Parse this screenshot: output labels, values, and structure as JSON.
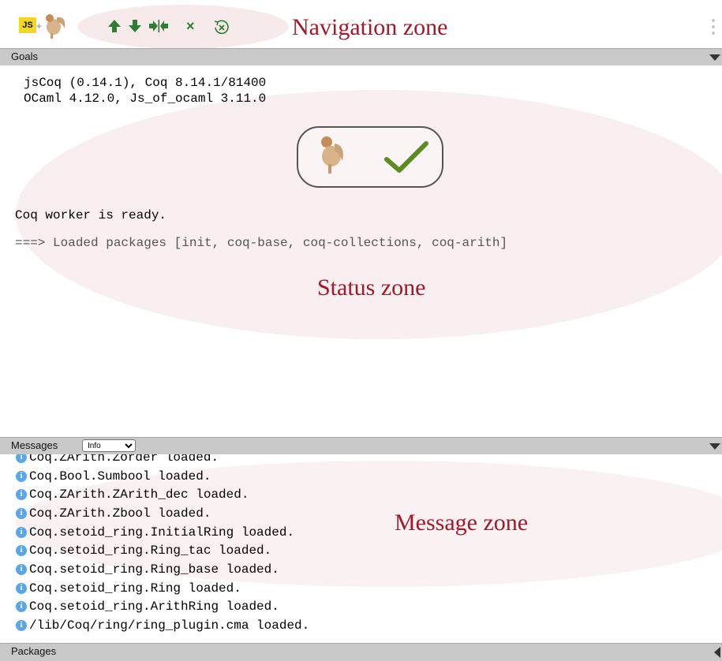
{
  "toolbar": {
    "js_logo": "JS",
    "plus": "+",
    "buttons": [
      {
        "name": "up-arrow-icon",
        "label": "▲"
      },
      {
        "name": "down-arrow-icon",
        "label": "▼"
      },
      {
        "name": "to-cursor-icon",
        "label": "▶|◀"
      },
      {
        "name": "close-icon",
        "label": "×"
      },
      {
        "name": "reset-icon",
        "label": "↺"
      }
    ]
  },
  "annotations": {
    "navigation": "Navigation zone",
    "status": "Status zone",
    "message": "Message zone"
  },
  "goals_panel": {
    "title": "Goals",
    "version_line1": "jsCoq (0.14.1), Coq 8.14.1/81400",
    "version_line2": "OCaml 4.12.0, Js_of_ocaml 3.11.0",
    "worker_status": "Coq worker is ready.",
    "loaded_packages": "===> Loaded packages [init, coq-base, coq-collections, coq-arith]"
  },
  "messages_panel": {
    "title": "Messages",
    "filter_selected": "Info",
    "items": [
      "Coq.ZArith.Zorder loaded.",
      "Coq.Bool.Sumbool loaded.",
      "Coq.ZArith.ZArith_dec loaded.",
      "Coq.ZArith.Zbool loaded.",
      "Coq.setoid_ring.InitialRing loaded.",
      "Coq.setoid_ring.Ring_tac loaded.",
      "Coq.setoid_ring.Ring_base loaded.",
      "Coq.setoid_ring.Ring loaded.",
      "Coq.setoid_ring.ArithRing loaded.",
      "/lib/Coq/ring/ring_plugin.cma loaded."
    ]
  },
  "packages_panel": {
    "title": "Packages"
  },
  "colors": {
    "accent_green": "#2e7d32",
    "annotation_red": "#a4182a",
    "info_blue": "#5aa7e8",
    "header_gray": "#c9c9c9"
  }
}
